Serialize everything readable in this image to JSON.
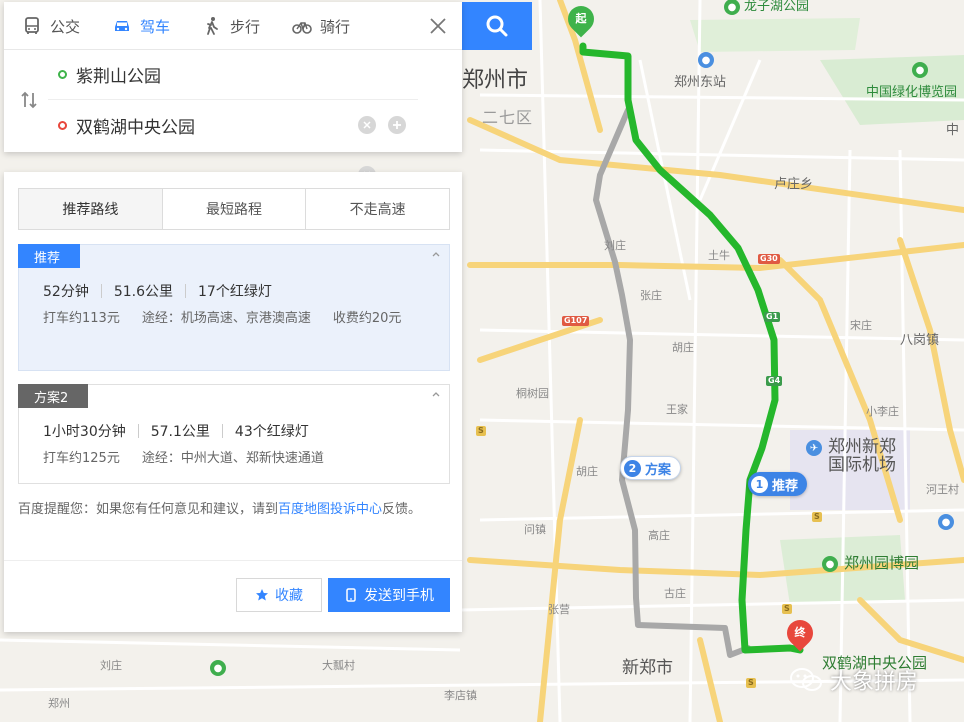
{
  "map": {
    "labels": {
      "longzi_park": "龙子湖公园",
      "zhengzhou_city": "郑州市",
      "erqi_district": "二七区",
      "zhengzhou_east_station": "郑州东站",
      "china_greening_expo": "中国绿化博览园",
      "zhong": "中",
      "luzhuang": "卢庄乡",
      "lizhuang": "刘庄",
      "tuniu": "土牛",
      "zhangzhuang": "张庄",
      "bazhai": "宋庄",
      "xinzhuang": "小李庄",
      "hushi": "胡庄",
      "bajia": "八岗镇",
      "tongsi": "桐树园",
      "wangjia": "王家",
      "xiaoli": "小李庄",
      "airport": "郑州新郑国际机场",
      "expo_garden": "郑州园博园",
      "huzhuang": "胡庄",
      "gaozhuang": "高庄",
      "wenzhuang": "问镇",
      "zhangying": "张营",
      "xinzheng_city": "新郑市",
      "liuzhuang_s": "刘庄",
      "dazhai": "大瓢村",
      "xingzhuang": "李店镇",
      "gu_zhuang": "古庄",
      "mingquan": "河王村",
      "sheng": "郑州"
    },
    "shields": {
      "g1": "G1",
      "g4": "G4",
      "g107": "G107",
      "g30": "G30",
      "s": "S"
    },
    "route_tags": {
      "primary_num": "1",
      "primary_label": "推荐",
      "alt_num": "2",
      "alt_label": "方案"
    },
    "pins": {
      "start": "起",
      "end": "终"
    },
    "destination_label": "双鹤湖中央公园",
    "watermark": "大象拼房"
  },
  "modes": [
    {
      "label": "公交",
      "icon": "bus-icon"
    },
    {
      "label": "驾车",
      "icon": "car-icon"
    },
    {
      "label": "步行",
      "icon": "walk-icon"
    },
    {
      "label": "骑行",
      "icon": "bike-icon"
    }
  ],
  "route_inputs": {
    "start": "紫荆山公园",
    "end": "双鹤湖中央公园"
  },
  "preferences": [
    {
      "label": "推荐路线"
    },
    {
      "label": "最短路程"
    },
    {
      "label": "不走高速"
    }
  ],
  "routes": [
    {
      "badge": "推荐",
      "duration": "52分钟",
      "distance": "51.6公里",
      "lights": "17个红绿灯",
      "taxi": "打车约113元",
      "via": "途经：机场高速、京港澳高速",
      "toll": "收费约20元"
    },
    {
      "badge": "方案2",
      "duration": "1小时30分钟",
      "distance": "57.1公里",
      "lights": "43个红绿灯",
      "taxi": "打车约125元",
      "via": "途经：中州大道、郑新快速通道"
    }
  ],
  "feedback": {
    "prefix": "百度提醒您：如果您有任何意见和建议，请到",
    "link": "百度地图投诉中心",
    "suffix": "反馈。"
  },
  "buttons": {
    "favorite": "收藏",
    "send": "发送到手机"
  },
  "colors": {
    "accent": "#3385ff",
    "route_primary": "#25b72c",
    "route_alt": "#a8a8a8",
    "start_green": "#3eb34a",
    "end_red": "#e8473c"
  }
}
